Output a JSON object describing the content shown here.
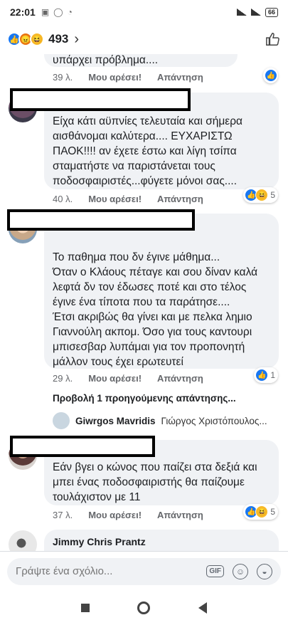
{
  "status": {
    "time": "22:01",
    "battery": "66"
  },
  "reactions": {
    "count": "493"
  },
  "comments": [
    {
      "partial_text": "υπάρχει πρόβλημα....",
      "time": "39 λ.",
      "like": "Μου αρέσει!",
      "reply": "Απάντηση"
    },
    {
      "text": "Είχα κάτι αϋπνίες τελευταία και σήμερα αισθάνομαι καλύτερα.... ΕΥΧΑΡΙΣΤΩ ΠΑΟΚ!!!! αν έχετε έστω και λίγη τσίπα σταματήστε να παριστάνεται τους ποδοσφαιριστές...φύγετε μόνοι σας....",
      "time": "40 λ.",
      "like": "Μου αρέσει!",
      "reply": "Απάντηση",
      "reaction_count": "5"
    },
    {
      "text": "Το παθημα που δν έγινε μάθημα...\nΌταν ο Κλάους πέταγε και σου δίναν καλά λεφτά δν τον έδωσες ποτέ και στο τέλος έγινε ένα τίποτα που τα παράτησε....\nΈτσι ακριβώς θα γίνει και με πελκα λημιο Γιαννούλη ακπομ. Όσο για τους καντουρι μπισεσβαρ λυπάμαι για τον προπονητή μάλλον τους έχει ερωτευτεί",
      "time": "29 λ.",
      "like": "Μου αρέσει!",
      "reply": "Απάντηση",
      "reaction_count": "1"
    },
    {
      "text": "Εάν βγει ο κώνος που παίζει στα δεξιά και μπει ένας ποδοσφαιριστής θα παίζουμε τουλάχιστον με 11",
      "time": "37 λ.",
      "like": "Μου αρέσει!",
      "reply": "Απάντηση",
      "reaction_count": "5"
    }
  ],
  "previous_replies": "Προβολή 1 προηγούμενης απάντησης...",
  "reply_preview": {
    "name": "Giwrgos Mavridis",
    "text": "Γιώργος Χριστόπουλος..."
  },
  "last_commenter": "Jimmy Chris Prantz",
  "composer": {
    "placeholder": "Γράψτε ένα σχόλιο...",
    "gif": "GIF"
  }
}
